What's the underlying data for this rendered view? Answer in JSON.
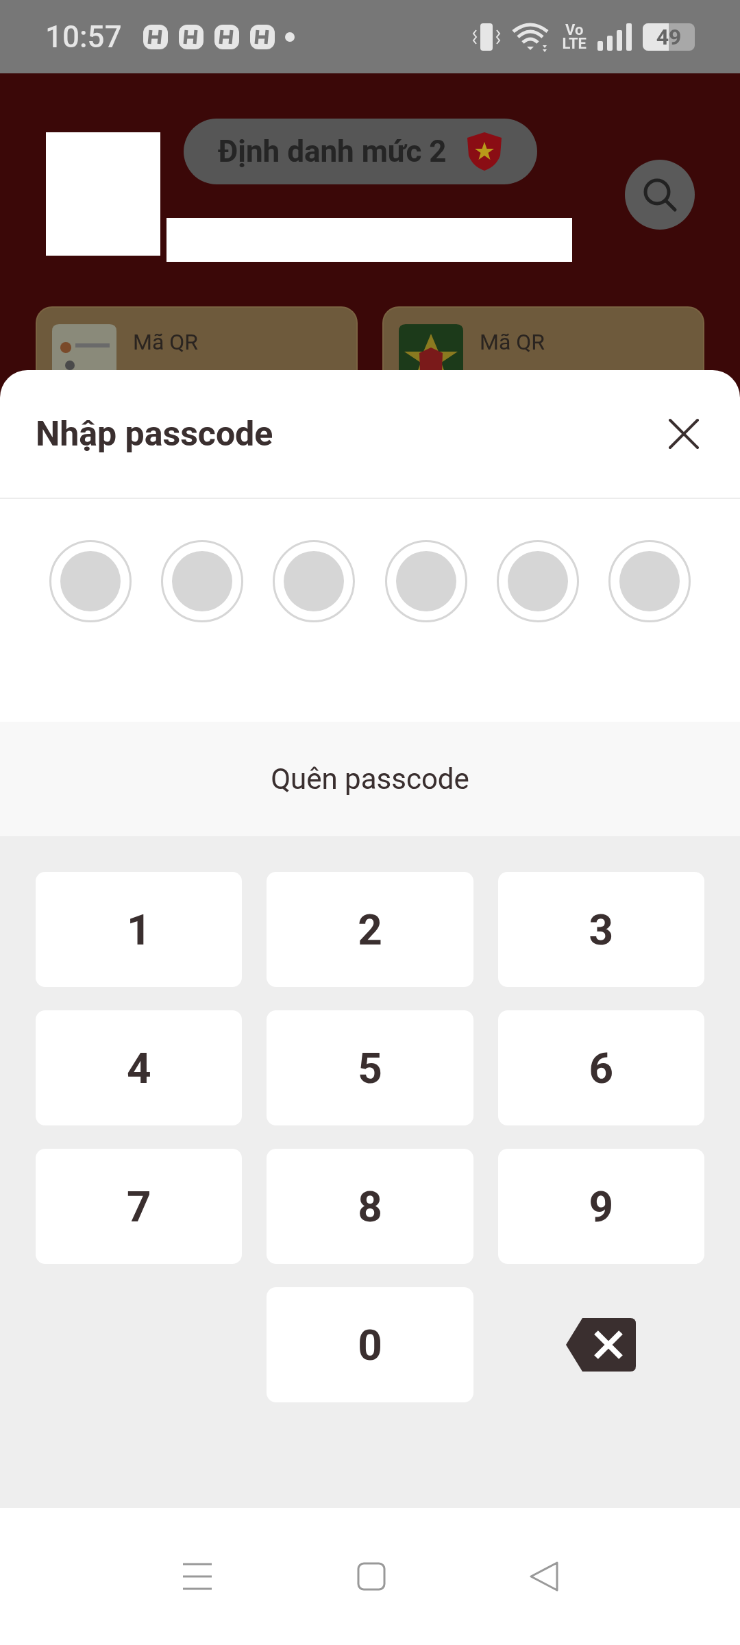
{
  "status_bar": {
    "time": "10:57",
    "volte": [
      "Vo",
      "LTE"
    ],
    "battery": "49"
  },
  "header": {
    "badge": "Định danh mức 2",
    "cards": [
      {
        "title": "Mã QR",
        "kind": "id_card"
      },
      {
        "title": "Mã QR",
        "kind": "emblem"
      }
    ]
  },
  "sheet": {
    "title": "Nhập passcode",
    "dots": [
      {
        "filled": false
      },
      {
        "filled": false
      },
      {
        "filled": false
      },
      {
        "filled": false
      },
      {
        "filled": false
      },
      {
        "filled": false
      }
    ],
    "forgot": "Quên passcode",
    "keys": [
      {
        "kind": "digit",
        "label": "1"
      },
      {
        "kind": "digit",
        "label": "2"
      },
      {
        "kind": "digit",
        "label": "3"
      },
      {
        "kind": "digit",
        "label": "4"
      },
      {
        "kind": "digit",
        "label": "5"
      },
      {
        "kind": "digit",
        "label": "6"
      },
      {
        "kind": "digit",
        "label": "7"
      },
      {
        "kind": "digit",
        "label": "8"
      },
      {
        "kind": "digit",
        "label": "9"
      },
      {
        "kind": "blank"
      },
      {
        "kind": "digit",
        "label": "0"
      },
      {
        "kind": "backspace"
      }
    ]
  }
}
